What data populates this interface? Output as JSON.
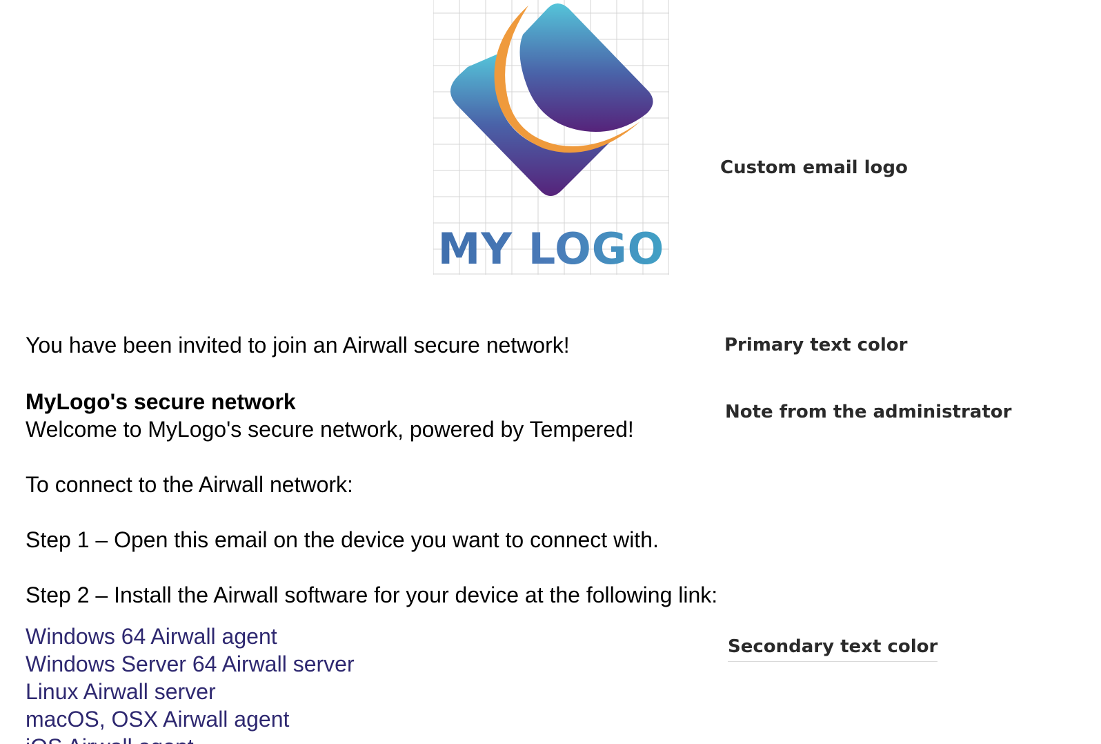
{
  "logo": {
    "text": "MY LOGO",
    "colors": {
      "gradient_top": "#55c4d9",
      "gradient_bottom": "#56237a",
      "swoosh": "#ef9a3c",
      "grid": "#d4d4d4"
    }
  },
  "annotations": {
    "logo": "Custom email logo",
    "primary_text_color": "Primary text color",
    "note_from_admin": "Note from the administrator",
    "secondary_text_color": "Secondary text color"
  },
  "email": {
    "invite": "You have been invited to join an Airwall secure network!",
    "network_name": "MyLogo's secure network",
    "welcome": "Welcome to MyLogo's secure network, powered by Tempered!",
    "connect_intro": "To connect to the Airwall network:",
    "step1": "Step 1 – Open this email on the device you want to connect with.",
    "step2": "Step 2 – Install the Airwall software for your device at the following link:",
    "links": [
      "Windows 64 Airwall agent",
      "Windows Server 64 Airwall server",
      "Linux Airwall server",
      "macOS, OSX Airwall agent",
      "iOS Airwall agent"
    ],
    "primary_color": "#000000",
    "secondary_color": "#2e2870"
  }
}
